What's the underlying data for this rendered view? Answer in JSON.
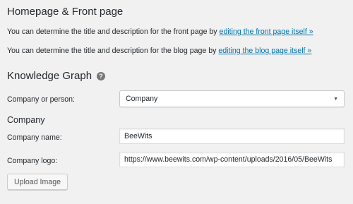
{
  "homepage_section": {
    "title": "Homepage & Front page",
    "front_page_text": "You can determine the title and description for the front page by ",
    "front_page_link": "editing the front page itself »",
    "blog_page_text": "You can determine the title and description for the blog page by ",
    "blog_page_link": "editing the blog page itself »"
  },
  "knowledge_graph": {
    "title": "Knowledge Graph",
    "help_icon": "?",
    "company_or_person_label": "Company or person:",
    "company_or_person_value": "Company"
  },
  "company_section": {
    "title": "Company",
    "name_label": "Company name:",
    "name_value": "BeeWits",
    "logo_label": "Company logo:",
    "logo_value": "https://www.beewits.com/wp-content/uploads/2016/05/BeeWits",
    "upload_button": "Upload Image"
  }
}
